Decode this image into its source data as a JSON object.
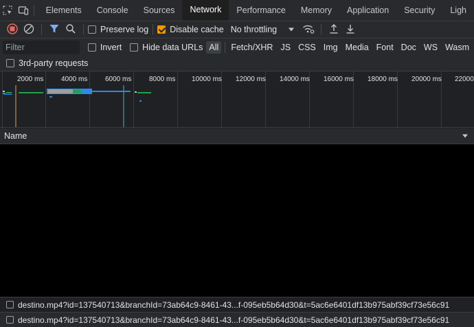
{
  "tabbar": {
    "tabs": [
      {
        "label": "Elements"
      },
      {
        "label": "Console"
      },
      {
        "label": "Sources"
      },
      {
        "label": "Network"
      },
      {
        "label": "Performance"
      },
      {
        "label": "Memory"
      },
      {
        "label": "Application"
      },
      {
        "label": "Security"
      },
      {
        "label": "Ligh"
      }
    ],
    "active_tab": "Network"
  },
  "toolbar": {
    "preserve_log_label": "Preserve log",
    "preserve_log_checked": false,
    "disable_cache_label": "Disable cache",
    "disable_cache_checked": true,
    "throttling_value": "No throttling"
  },
  "filter": {
    "placeholder": "Filter",
    "invert_label": "Invert",
    "hide_data_urls_label": "Hide data URLs",
    "types": [
      "All",
      "Fetch/XHR",
      "JS",
      "CSS",
      "Img",
      "Media",
      "Font",
      "Doc",
      "WS",
      "Wasm"
    ],
    "active_type": "All",
    "third_party_label": "3rd-party requests"
  },
  "overview": {
    "ticks": [
      "2000 ms",
      "4000 ms",
      "6000 ms",
      "8000 ms",
      "10000 ms",
      "12000 ms",
      "14000 ms",
      "16000 ms",
      "18000 ms",
      "20000 ms",
      "22000"
    ]
  },
  "table": {
    "name_header": "Name"
  },
  "requests": [
    {
      "name": "destino.mp4?id=137540713&branchId=73ab64c9-8461-43...f-095eb5b64d30&t=5ac6e6401df13b975abf39cf73e56c91"
    },
    {
      "name": "destino.mp4?id=137540713&branchId=73ab64c9-8461-43...f-095eb5b64d30&t=5ac6e6401df13b975abf39cf73e56c91"
    }
  ],
  "colors": {
    "accent_checkbox": "#f29900",
    "record_red": "#e46962",
    "filter_blue": "#7cacf8",
    "bar_blue": "#2a8be8",
    "bar_green": "#1ea446",
    "dom_line": "#2ec4d6",
    "load_line": "#e8a15c"
  }
}
